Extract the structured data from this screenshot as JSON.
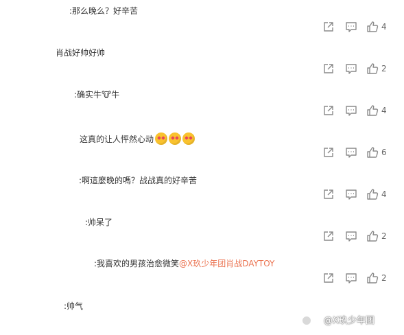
{
  "comments": [
    {
      "text": ":那么晚么？好辛苦",
      "mention": "",
      "likes": "4"
    },
    {
      "text": "肖战好帅好帅",
      "mention": "",
      "likes": "2"
    },
    {
      "text": ":确实牛🐮牛",
      "mention": "",
      "likes": "4"
    },
    {
      "text": "这真的让人怦然心动",
      "mention": "",
      "likes": "6"
    },
    {
      "text": ":啊這麼晚的嗎？战战真的好辛苦",
      "mention": "",
      "likes": "4"
    },
    {
      "text": ":帅呆了",
      "mention": "",
      "likes": "2"
    },
    {
      "text": ":我喜欢的男孩治愈微笑",
      "mention": "@X玖少年团肖战DAYTOY",
      "likes": "2"
    },
    {
      "text": ":帅气",
      "mention": "",
      "likes": ""
    }
  ],
  "icons": {
    "share": "share-icon",
    "reply": "comment-icon",
    "like": "thumbs-up-icon",
    "emoji": "heart-eyes-emoji-icon"
  },
  "colors": {
    "text": "#333333",
    "mention": "#eb7350",
    "icon": "#8a8a8a"
  },
  "watermark": {
    "text": "@X玖少年团"
  }
}
